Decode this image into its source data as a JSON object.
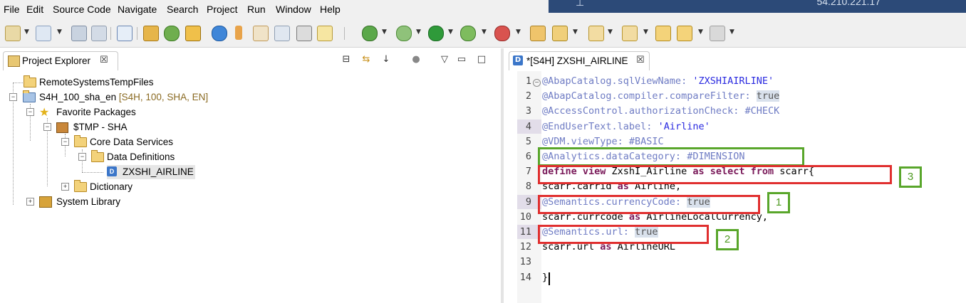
{
  "menubar": {
    "items": [
      "File",
      "Edit",
      "Source Code",
      "Navigate",
      "Search",
      "Project",
      "Run",
      "Window",
      "Help"
    ],
    "remote_ip_partial": "54.210.221.17"
  },
  "project_explorer": {
    "tab_title": "Project Explorer",
    "tab_close": "☒",
    "tree": [
      {
        "label": "RemoteSystemsTempFiles",
        "extra": ""
      },
      {
        "label": "S4H_100_sha_en",
        "extra": " [S4H, 100, SHA, EN]"
      },
      {
        "label": "Favorite Packages",
        "extra": ""
      },
      {
        "label": "$TMP - SHA",
        "extra": ""
      },
      {
        "label": "Core Data Services",
        "extra": ""
      },
      {
        "label": "Data Definitions",
        "extra": ""
      },
      {
        "label": "ZXSHI_AIRLINE",
        "extra": ""
      },
      {
        "label": "Dictionary",
        "extra": ""
      },
      {
        "label": "System Library",
        "extra": ""
      }
    ]
  },
  "editor": {
    "tab_title": "*[S4H] ZXSHI_AIRLINE",
    "tab_close": "☒",
    "lines": [
      {
        "num": "1",
        "parts": [
          [
            "anno",
            "@AbapCatalog.sqlViewName: "
          ],
          [
            "str",
            "'ZXSHIAIRLINE'"
          ]
        ]
      },
      {
        "num": "2",
        "parts": [
          [
            "anno",
            "@AbapCatalog.compiler.compareFilter: "
          ],
          [
            "hl",
            "true"
          ]
        ]
      },
      {
        "num": "3",
        "parts": [
          [
            "anno",
            "@AccessControl.authorizationCheck: #CHECK"
          ]
        ]
      },
      {
        "num": "4",
        "parts": [
          [
            "anno",
            "@EndUserText.label: "
          ],
          [
            "str",
            "'Airline'"
          ]
        ]
      },
      {
        "num": "5",
        "parts": [
          [
            "anno",
            "@VDM.viewType: #BASIC"
          ]
        ]
      },
      {
        "num": "6",
        "parts": [
          [
            "anno",
            "@Analytics.dataCategory: #DIMENSION"
          ]
        ]
      },
      {
        "num": "7",
        "parts": [
          [
            "kw",
            "define view "
          ],
          [
            "ident",
            "ZxshI_Airline "
          ],
          [
            "kw",
            "as select from "
          ],
          [
            "ident",
            "scarr{"
          ]
        ]
      },
      {
        "num": "8",
        "parts": [
          [
            "ident",
            "scarr.carrid "
          ],
          [
            "kw",
            "as "
          ],
          [
            "ident",
            "Airline,"
          ]
        ]
      },
      {
        "num": "9",
        "parts": [
          [
            "anno",
            "@Semantics.currencyCode: "
          ],
          [
            "hl",
            "true"
          ]
        ]
      },
      {
        "num": "10",
        "parts": [
          [
            "ident",
            "scarr.currcode "
          ],
          [
            "kw",
            "as "
          ],
          [
            "ident",
            "AirlineLocalCurrency,"
          ]
        ]
      },
      {
        "num": "11",
        "parts": [
          [
            "anno",
            "@Semantics.url: "
          ],
          [
            "hl",
            "true"
          ]
        ]
      },
      {
        "num": "12",
        "parts": [
          [
            "ident",
            "scarr.url "
          ],
          [
            "kw",
            "as "
          ],
          [
            "ident",
            "AirlineURL"
          ]
        ]
      },
      {
        "num": "13",
        "parts": []
      },
      {
        "num": "14",
        "parts": [
          [
            "ident",
            "}"
          ]
        ]
      }
    ],
    "fold_marker": "−"
  },
  "callouts": {
    "badge_1": "1",
    "badge_2": "2",
    "badge_3": "3"
  },
  "colors": {
    "red_box": "#e02f2f",
    "green_box": "#59a62b",
    "annotation_text": "#6f7cc4",
    "keyword_text": "#7a1a5a"
  }
}
